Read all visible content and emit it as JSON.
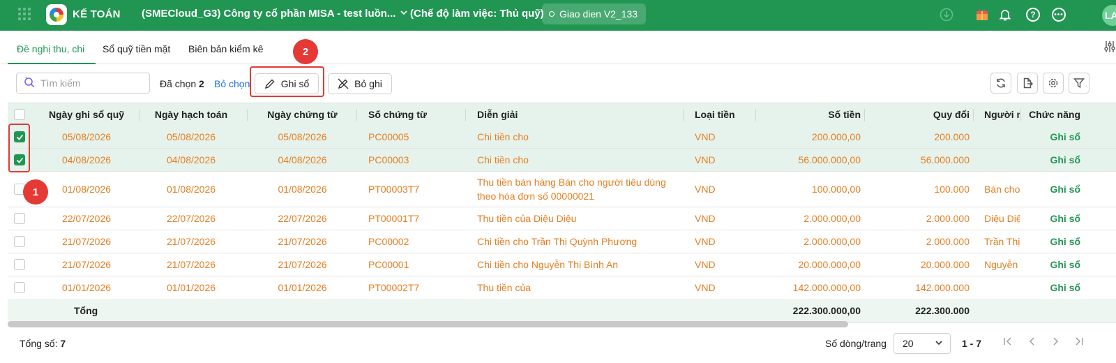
{
  "topbar": {
    "app_name": "KẾ TOÁN",
    "company": "(SMECloud_G3) Công ty cổ phần MISA - test luồn...",
    "work_mode": "(Chế độ làm việc: Thủ quỹ)",
    "ui_version": "Giao dien V2_133",
    "avatar_initials": "LA",
    "colors": {
      "bar": "#219653",
      "accent": "#219653"
    }
  },
  "tabs": [
    {
      "label": "Đề nghị thu, chi",
      "active": true
    },
    {
      "label": "Sổ quỹ tiền mặt",
      "active": false
    },
    {
      "label": "Biên bản kiểm kê",
      "active": false
    }
  ],
  "toolbar": {
    "search_placeholder": "Tìm kiếm",
    "selected_prefix": "Đã chọn",
    "selected_count": "2",
    "deselect_label": "Bỏ chọn",
    "post_label": "Ghi sổ",
    "unpost_label": "Bỏ ghi"
  },
  "annotations": [
    "1",
    "2"
  ],
  "table": {
    "headers": [
      "Ngày ghi sổ quỹ",
      "Ngày hạch toán",
      "Ngày chứng từ",
      "Số chứng từ",
      "Diễn giải",
      "Loại tiền",
      "Số tiền",
      "Quy đổi",
      "Người n",
      "Chức năng"
    ],
    "rows": [
      {
        "checked": true,
        "c0": "05/08/2026",
        "c1": "05/08/2026",
        "c2": "05/08/2026",
        "c3": "PC00005",
        "c4": "Chi tiền cho",
        "c5": "VND",
        "c6": "200.000,00",
        "c7": "200.000",
        "c8": "",
        "c9": "Ghi sổ"
      },
      {
        "checked": true,
        "c0": "04/08/2026",
        "c1": "04/08/2026",
        "c2": "04/08/2026",
        "c3": "PC00003",
        "c4": "Chi tiền cho",
        "c5": "VND",
        "c6": "56.000.000,00",
        "c7": "56.000.000",
        "c8": "",
        "c9": "Ghi sổ"
      },
      {
        "checked": false,
        "c0": "01/08/2026",
        "c1": "01/08/2026",
        "c2": "01/08/2026",
        "c3": "PT00003T7",
        "c4": "Thu tiền bán hàng Bán cho người tiêu dùng theo hóa đơn số 00000021",
        "c5": "VND",
        "c6": "100.000,00",
        "c7": "100.000",
        "c8": "Bán cho",
        "c9": "Ghi sổ"
      },
      {
        "checked": false,
        "c0": "22/07/2026",
        "c1": "22/07/2026",
        "c2": "22/07/2026",
        "c3": "PT00001T7",
        "c4": "Thu tiền của Diệu Diệu",
        "c5": "VND",
        "c6": "2.000.000,00",
        "c7": "2.000.000",
        "c8": "Diệu Diệ",
        "c9": "Ghi sổ"
      },
      {
        "checked": false,
        "c0": "21/07/2026",
        "c1": "21/07/2026",
        "c2": "21/07/2026",
        "c3": "PC00002",
        "c4": "Chi tiền cho Trần Thị Quỳnh Phương",
        "c5": "VND",
        "c6": "2.000.000,00",
        "c7": "2.000.000",
        "c8": "Trần Thị",
        "c9": "Ghi sổ"
      },
      {
        "checked": false,
        "c0": "21/07/2026",
        "c1": "21/07/2026",
        "c2": "21/07/2026",
        "c3": "PC00001",
        "c4": "Chi tiền cho Nguyễn Thị Bình An",
        "c5": "VND",
        "c6": "20.000.000,00",
        "c7": "20.000.000",
        "c8": "Nguyễn",
        "c9": "Ghi sổ"
      },
      {
        "checked": false,
        "c0": "01/01/2026",
        "c1": "01/01/2026",
        "c2": "01/01/2026",
        "c3": "PT00002T7",
        "c4": "Thu tiền của",
        "c5": "VND",
        "c6": "142.000.000,00",
        "c7": "142.000.000",
        "c8": "",
        "c9": "Ghi sổ"
      }
    ],
    "total_label": "Tổng",
    "total_amount": "222.300.000,00",
    "total_converted": "222.300.000"
  },
  "footer": {
    "total_prefix": "Tổng số:",
    "total_count": "7",
    "rows_per_page_label": "Số dòng/trang",
    "rows_per_page": "20",
    "page_range": "1 - 7"
  }
}
